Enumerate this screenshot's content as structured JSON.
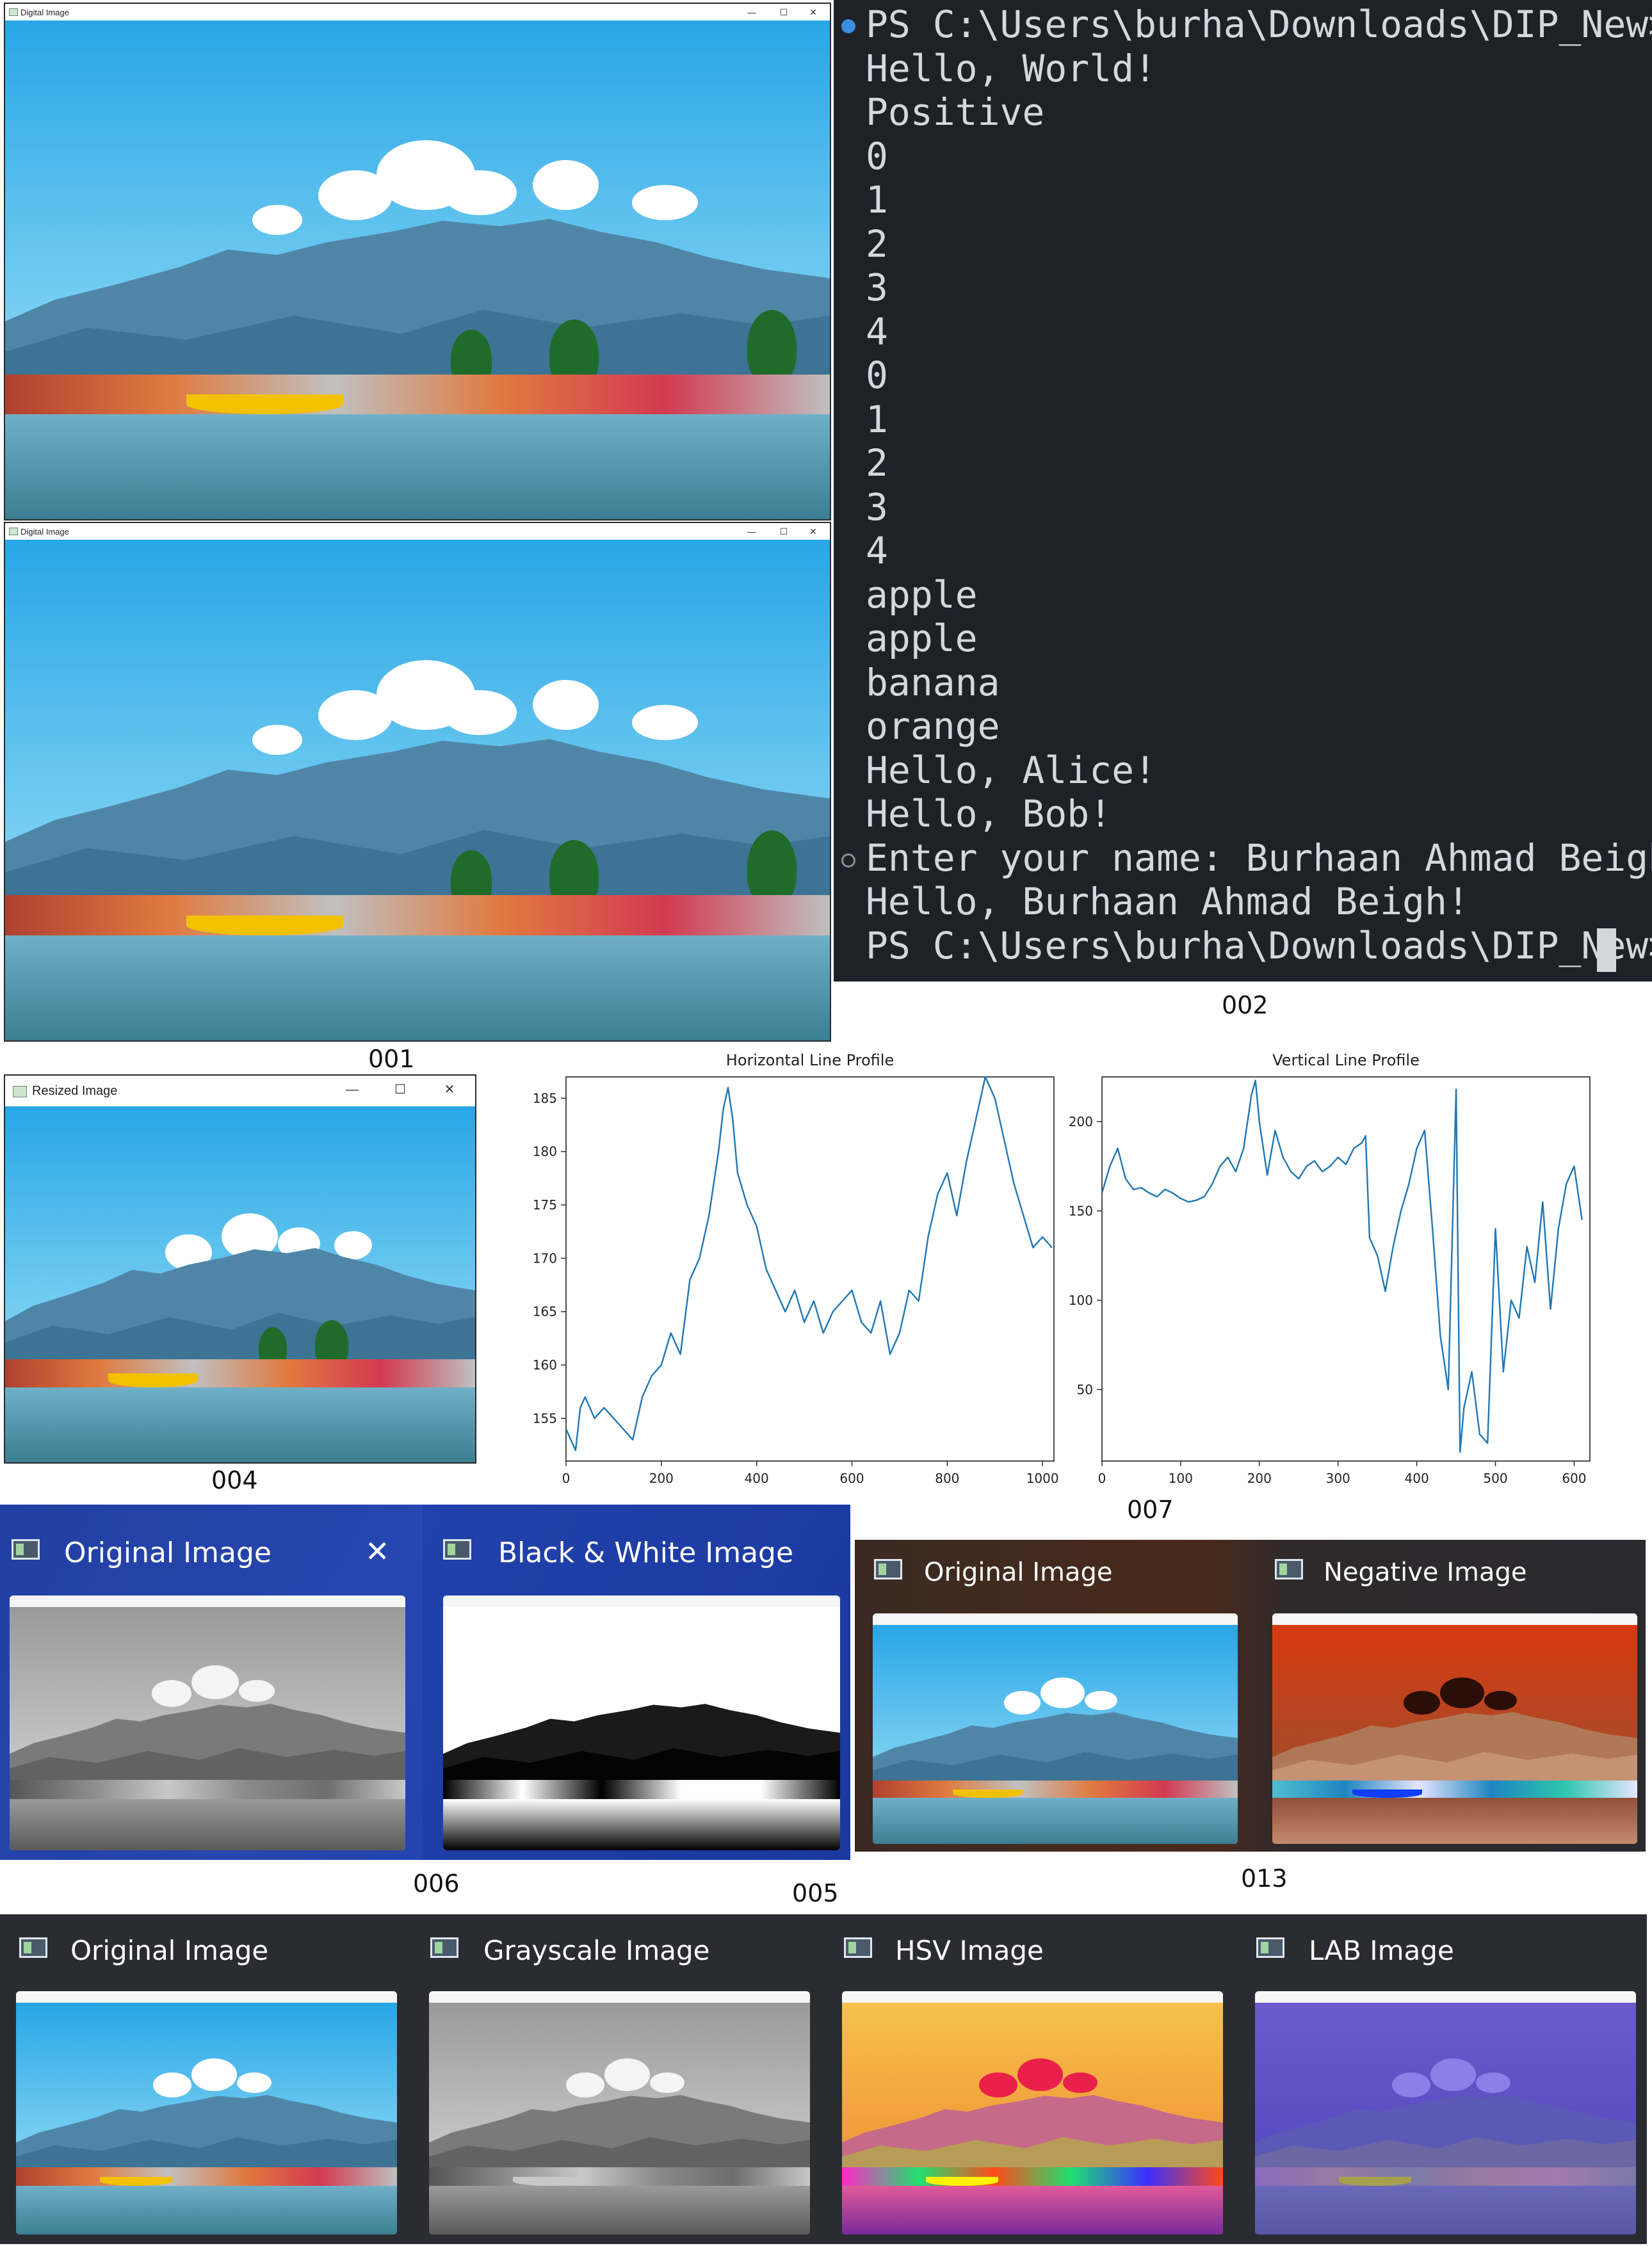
{
  "windows": {
    "digital_1": {
      "title": "Digital Image"
    },
    "digital_2": {
      "title": "Digital Image"
    },
    "resized": {
      "title": "Resized Image"
    },
    "controls": {
      "minimize": "—",
      "maximize": "☐",
      "close": "✕"
    }
  },
  "terminal": {
    "lines": [
      "PS C:\\Users\\burha\\Downloads\\DIP_New> & ",
      "Hello, World!",
      "Positive",
      "0",
      "1",
      "2",
      "3",
      "4",
      "0",
      "1",
      "2",
      "3",
      "4",
      "apple",
      "apple",
      "banana",
      "orange",
      "Hello, Alice!",
      "Hello, Bob!",
      "Enter your name: Burhaan Ahmad Beigh",
      "Hello, Burhaan Ahmad Beigh!",
      "PS C:\\Users\\burha\\Downloads\\DIP_New> "
    ],
    "prompt_dot_color": "#3b8ee0",
    "background": "#1e2128"
  },
  "captions": {
    "c001": "001",
    "c002": "002",
    "c004": "004",
    "c007": "007",
    "c006": "006",
    "c005": "005",
    "c013": "013"
  },
  "previews": {
    "bw": {
      "left": "Original Image",
      "right": "Black & White Image",
      "close": "✕"
    },
    "neg": {
      "left": "Original Image",
      "right": "Negative Image"
    },
    "spaces": {
      "p1": "Original Image",
      "p2": "Grayscale Image",
      "p3": "HSV Image",
      "p4": "LAB Image"
    }
  },
  "chart_data": [
    {
      "type": "line",
      "title": "Horizontal Line Profile",
      "xlabel": "",
      "ylabel": "",
      "xlim": [
        0,
        1024
      ],
      "ylim": [
        151,
        187
      ],
      "xticks": [
        0,
        200,
        400,
        600,
        800,
        1000
      ],
      "yticks": [
        155,
        160,
        165,
        170,
        175,
        180,
        185
      ],
      "grid": false,
      "color": "#1f77b4",
      "series": [
        {
          "x": [
            0,
            20,
            30,
            40,
            60,
            80,
            100,
            120,
            140,
            160,
            180,
            200,
            220,
            240,
            260,
            280,
            300,
            320,
            330,
            340,
            350,
            360,
            380,
            400,
            420,
            440,
            460,
            480,
            500,
            520,
            540,
            560,
            580,
            600,
            620,
            640,
            660,
            680,
            700,
            720,
            740,
            760,
            780,
            800,
            820,
            840,
            860,
            880,
            900,
            920,
            940,
            960,
            980,
            1000,
            1020
          ],
          "y": [
            154,
            152,
            156,
            157,
            155,
            156,
            155,
            154,
            153,
            157,
            159,
            160,
            163,
            161,
            168,
            170,
            174,
            180,
            184,
            186,
            183,
            178,
            175,
            173,
            169,
            167,
            165,
            167,
            164,
            166,
            163,
            165,
            166,
            167,
            164,
            163,
            166,
            161,
            163,
            167,
            166,
            172,
            176,
            178,
            174,
            179,
            183,
            187,
            185,
            181,
            177,
            174,
            171,
            172,
            171
          ]
        }
      ]
    },
    {
      "type": "line",
      "title": "Vertical Line Profile",
      "xlabel": "",
      "ylabel": "",
      "xlim": [
        0,
        620
      ],
      "ylim": [
        10,
        225
      ],
      "xticks": [
        0,
        100,
        200,
        300,
        400,
        500,
        600
      ],
      "yticks": [
        50,
        100,
        150,
        200
      ],
      "grid": false,
      "color": "#1f77b4",
      "series": [
        {
          "x": [
            0,
            10,
            20,
            30,
            40,
            50,
            60,
            70,
            80,
            90,
            100,
            110,
            120,
            130,
            140,
            150,
            160,
            170,
            180,
            190,
            195,
            200,
            210,
            220,
            230,
            240,
            250,
            260,
            270,
            280,
            290,
            300,
            310,
            320,
            330,
            335,
            340,
            350,
            360,
            370,
            380,
            390,
            400,
            410,
            420,
            430,
            440,
            450,
            455,
            460,
            470,
            480,
            490,
            500,
            510,
            520,
            530,
            540,
            550,
            560,
            570,
            580,
            590,
            600,
            610
          ],
          "y": [
            160,
            175,
            185,
            168,
            162,
            163,
            160,
            158,
            162,
            160,
            157,
            155,
            156,
            158,
            165,
            175,
            180,
            172,
            185,
            215,
            223,
            200,
            170,
            195,
            180,
            172,
            168,
            175,
            178,
            172,
            175,
            180,
            176,
            185,
            188,
            192,
            135,
            125,
            105,
            130,
            150,
            165,
            185,
            195,
            140,
            80,
            50,
            218,
            15,
            40,
            60,
            25,
            20,
            140,
            60,
            100,
            90,
            130,
            110,
            155,
            95,
            140,
            165,
            175,
            145
          ]
        }
      ]
    }
  ]
}
